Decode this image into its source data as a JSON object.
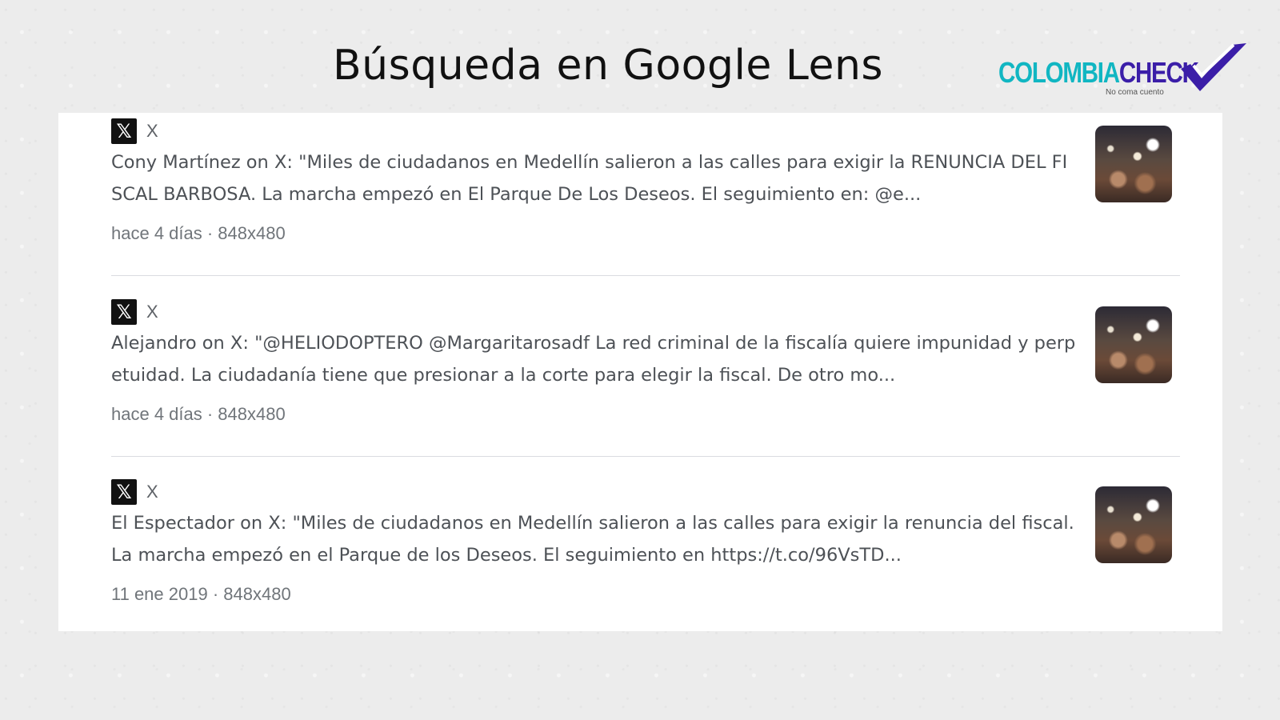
{
  "header": {
    "title": "Búsqueda en Google Lens"
  },
  "logo": {
    "part1": "COLOMBIA",
    "part2": "CHECK",
    "tagline": "No coma cuento",
    "colors": {
      "primary": "#11b6c2",
      "secondary": "#3b1ea8"
    }
  },
  "results": [
    {
      "source_icon": "x-logo-icon",
      "source": "X",
      "headline": "Cony Martínez on X: \"Miles de ciudadanos en Medellín salieron a las calles para exigir la RENUNCIA DEL FISCAL BARBOSA. La marcha empezó en El Parque De Los Deseos. El seguimiento en: @e...",
      "meta": "hace 4 días · 848x480"
    },
    {
      "source_icon": "x-logo-icon",
      "source": "X",
      "headline": "Alejandro on X: \"@HELIODOPTERO @Margaritarosadf La red criminal de la fiscalía quiere impunidad y perpetuidad. La ciudadanía tiene que presionar a la corte para elegir la fiscal. De otro mo...",
      "meta": "hace 4 días · 848x480"
    },
    {
      "source_icon": "x-logo-icon",
      "source": "X",
      "headline": "El Espectador on X: \"Miles de ciudadanos en Medellín salieron a las calles para exigir la renuncia del fiscal. La marcha empezó en el Parque de los Deseos. El seguimiento en https://t.co/96VsTD...",
      "meta": "11 ene 2019 · 848x480"
    }
  ]
}
